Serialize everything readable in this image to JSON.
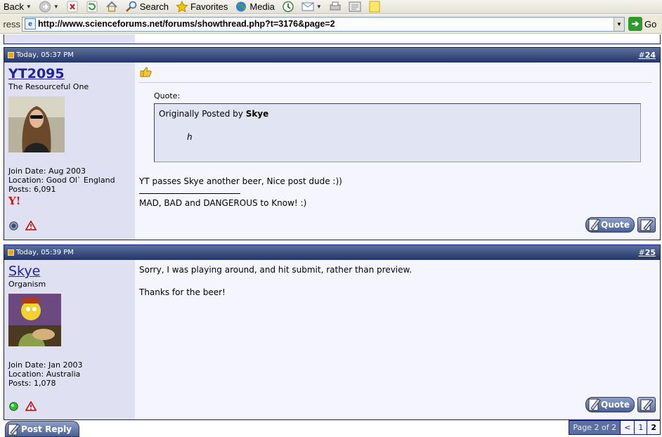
{
  "browser": {
    "toolbar": {
      "back_label": "Back",
      "search_label": "Search",
      "favorites_label": "Favorites",
      "media_label": "Media"
    },
    "address": {
      "label": "ress",
      "url": "http://www.scienceforums.net/forums/showthread.php?t=3176&page=2",
      "go_label": "Go"
    }
  },
  "posts": [
    {
      "time": "Today, 05:37 PM",
      "number_hash": "#",
      "number": "24",
      "username": "YT2095",
      "user_title": "The Resourceful One",
      "join_date": "Join Date: Aug 2003",
      "location": "Location: Good Ol` England",
      "posts": "Posts: 6,091",
      "quote_label": "Quote:",
      "quote_prefix": "Originally Posted by",
      "quote_author": "Skye",
      "quote_text": "h",
      "message": "YT passes Skye another beer, Nice post dude :))",
      "signature": "MAD, BAD and DANGEROUS to Know! :)",
      "quote_button": "Quote",
      "online": false
    },
    {
      "time": "Today, 05:39 PM",
      "number_hash": "#",
      "number": "25",
      "username": "Skye",
      "user_title": "Organism",
      "join_date": "Join Date: Jan 2003",
      "location": "Location: Australia",
      "posts": "Posts: 1,078",
      "message_line1": "Sorry, I was playing around, and hit submit, rather than preview.",
      "message_line2": "Thanks for the beer!",
      "quote_button": "Quote",
      "online": true
    }
  ],
  "footer": {
    "post_reply": "Post Reply",
    "page_info": "Page 2 of 2",
    "prev": "<",
    "page1": "1",
    "page2": "2"
  },
  "colors": {
    "header_dark": "#23356b",
    "user_panel": "#dfe1f3",
    "post_bg": "#f5f5ff",
    "link": "#22229c"
  }
}
